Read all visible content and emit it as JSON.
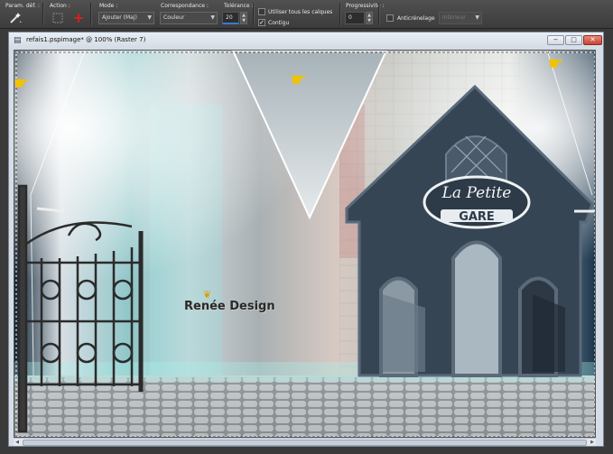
{
  "toolbar": {
    "presets_label": "Param. déf. :",
    "action_label": "Action :",
    "mode_label": "Mode :",
    "mode_value": "Ajouter (Maj)",
    "match_label": "Correspondance :",
    "match_value": "Couleur",
    "tolerance_label": "Tolérance :",
    "tolerance_value": "20",
    "use_all_layers_label": "Utiliser tous les calques",
    "contiguous_label": "Contigu",
    "feather_label": "Progressivité :",
    "feather_value": "0",
    "antialias_label": "Anticrénelage",
    "antialias_value": "Intérieur"
  },
  "document": {
    "title": "refais1.pspimage* @ 100% (Raster 7)",
    "minimize": "−",
    "maximize": "□",
    "close": "✕"
  },
  "artwork": {
    "sign_line1": "La Petite",
    "sign_line2": "GARE",
    "watermark": "Renée Design",
    "hand_icon": "pointing-hand-icon"
  }
}
